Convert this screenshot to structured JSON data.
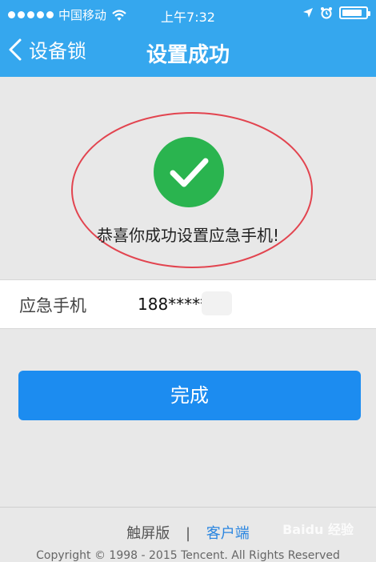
{
  "status_bar": {
    "carrier": "中国移动",
    "time": "上午7:32",
    "battery_level": 0.85
  },
  "nav": {
    "back_label": "设备锁",
    "title": "设置成功"
  },
  "success": {
    "message": "恭喜你成功设置应急手机!"
  },
  "phone": {
    "label": "应急手机",
    "value": "188*****"
  },
  "done_button": {
    "label": "完成"
  },
  "footer": {
    "touch_label": "触屏版",
    "separator": "|",
    "client_label": "客户端",
    "copyright": "Copyright © 1998 - 2015 Tencent. All Rights Reserved"
  },
  "watermark": {
    "text": "Baidu 经验"
  },
  "colors": {
    "header_blue": "#35a7ee",
    "success_green": "#2ab44f",
    "annotation_red": "#e2444f",
    "button_blue": "#1c8cf0",
    "link_blue": "#2b86e0"
  },
  "icons": [
    "signal-dots-icon",
    "wifi-icon",
    "location-arrow-icon",
    "alarm-icon",
    "battery-icon",
    "back-chevron-icon",
    "checkmark-icon"
  ]
}
